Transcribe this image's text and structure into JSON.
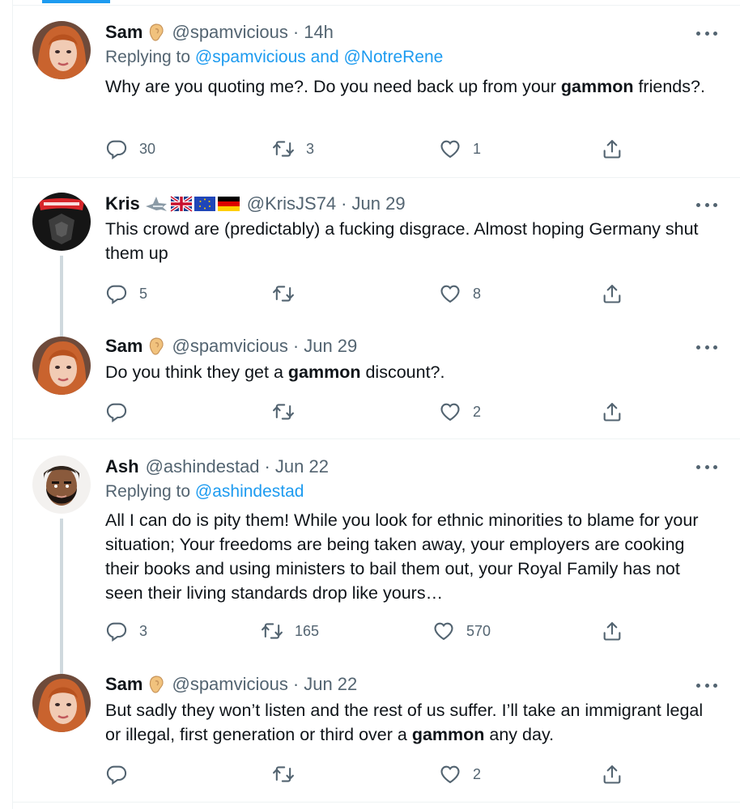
{
  "colors": {
    "link": "#1d9bf0",
    "secondary": "#536471",
    "text": "#0f1419",
    "divider": "#eff3f4",
    "thread": "#cfd9de"
  },
  "tweets": [
    {
      "name": "Sam",
      "name_emoji": "ear-icon",
      "handle": "@spamvicious",
      "sep": "·",
      "time": "14h",
      "replying_prefix": "Replying to",
      "replying_to": "@spamvicious and @NotreRene",
      "text_a": "Why are you quoting me?. Do you need back up from your ",
      "text_bold": "gammon",
      "text_b": " friends?.",
      "replies": "30",
      "retweets": "3",
      "likes": "1"
    },
    {
      "name": "Kris",
      "name_emoji": "shark-uk-eu-germany-flags",
      "handle": "@KrisJS74",
      "sep": "·",
      "time": "Jun 29",
      "text": "This crowd are (predictably) a fucking disgrace. Almost hoping Germany shut them up",
      "replies": "5",
      "retweets": "",
      "likes": "8"
    },
    {
      "name": "Sam",
      "name_emoji": "ear-icon",
      "handle": "@spamvicious",
      "sep": "·",
      "time": "Jun 29",
      "text_a": "Do you think they get a ",
      "text_bold": "gammon",
      "text_b": " discount?.",
      "replies": "",
      "retweets": "",
      "likes": "2"
    },
    {
      "name": "Ash",
      "handle": "@ashindestad",
      "sep": "·",
      "time": "Jun 22",
      "replying_prefix": "Replying to",
      "replying_to": "@ashindestad",
      "text": "All I can do is pity them! While you look for ethnic minorities to blame for your situation; Your freedoms are being taken away, your employers are cooking their books and using ministers to bail them out, your Royal Family has not seen their living standards drop like yours…",
      "replies": "3",
      "retweets": "165",
      "likes": "570"
    },
    {
      "name": "Sam",
      "name_emoji": "ear-icon",
      "handle": "@spamvicious",
      "sep": "·",
      "time": "Jun 22",
      "text_a": "But sadly they won’t listen and the rest of us suffer. I’ll take an immigrant legal or illegal, first generation or third over a ",
      "text_bold": "gammon",
      "text_b": " any day.",
      "replies": "",
      "retweets": "",
      "likes": "2"
    }
  ]
}
